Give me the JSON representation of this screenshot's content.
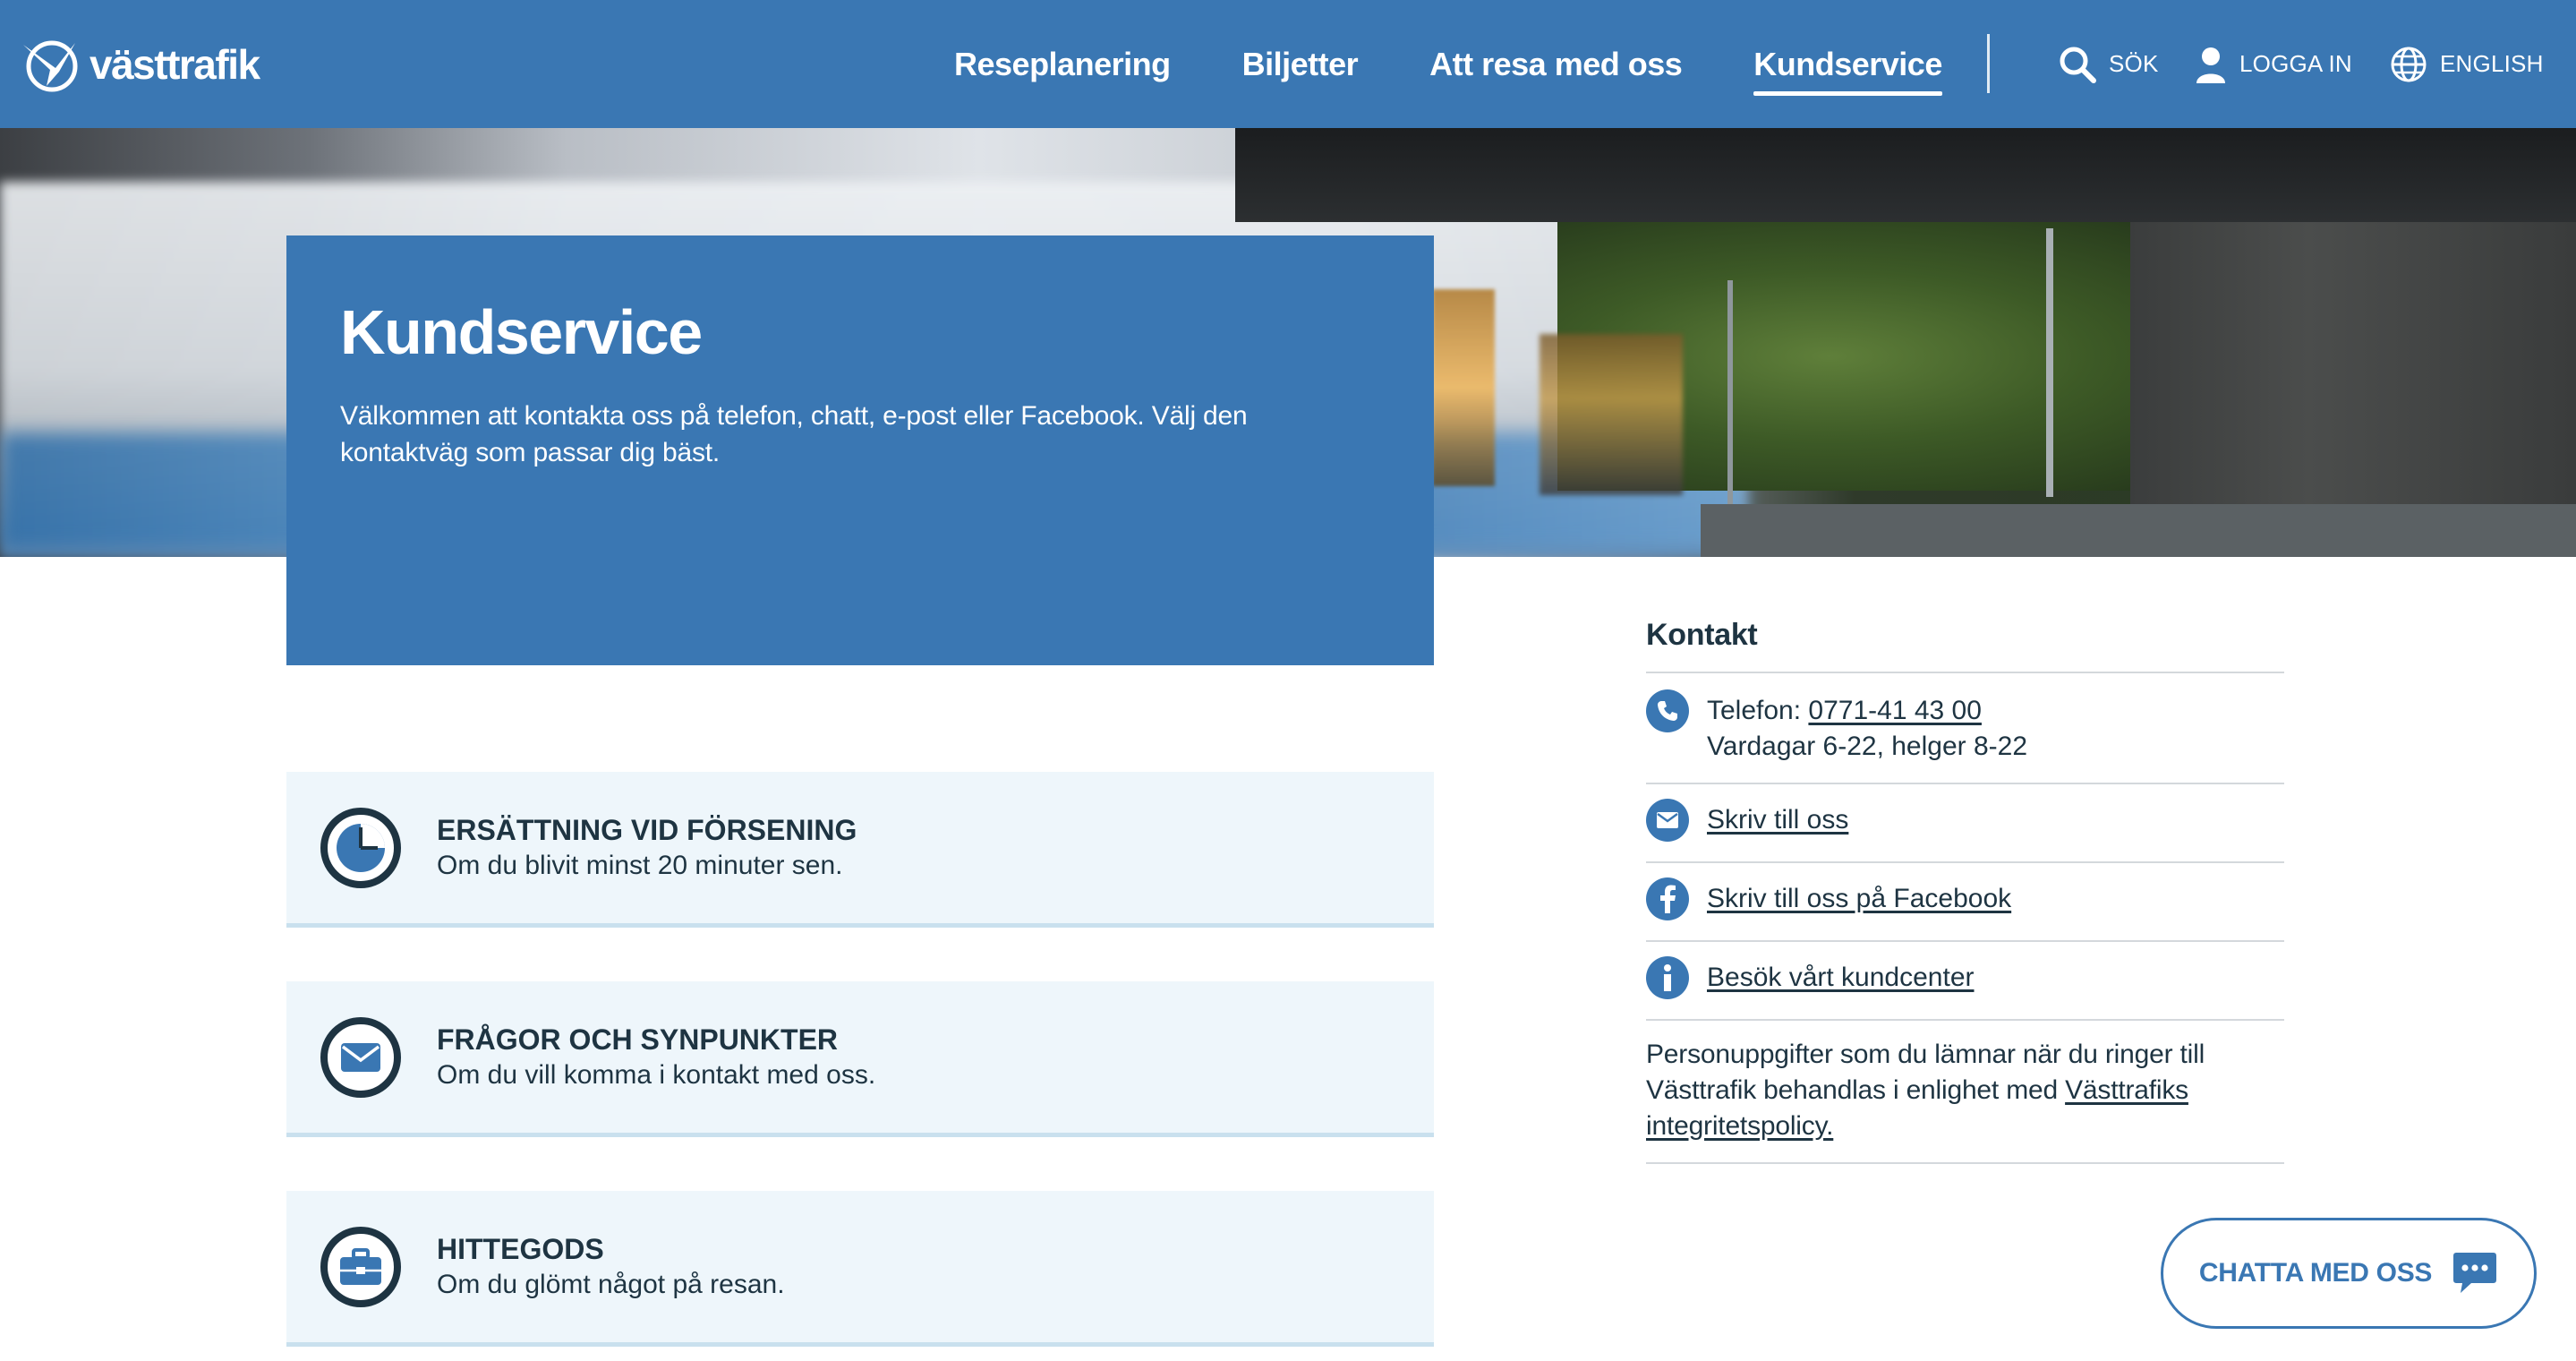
{
  "header": {
    "logo_text": "västtrafik",
    "nav": [
      {
        "label": "Reseplanering"
      },
      {
        "label": "Biljetter"
      },
      {
        "label": "Att resa med oss"
      },
      {
        "label": "Kundservice"
      }
    ],
    "active_nav": "Kundservice",
    "search_label": "SÖK",
    "login_label": "LOGGA IN",
    "lang_label": "ENGLISH"
  },
  "hero": {
    "title": "Kundservice",
    "intro": "Välkommen att kontakta oss på telefon, chatt, e-post eller Facebook. Välj den kontaktväg som passar dig bäst."
  },
  "cards": [
    {
      "title": "ERSÄTTNING VID FÖRSENING",
      "subtitle": "Om du blivit minst 20 minuter sen.",
      "icon": "clock-icon"
    },
    {
      "title": "FRÅGOR OCH SYNPUNKTER",
      "subtitle": "Om du vill komma i kontakt med oss.",
      "icon": "envelope-icon"
    },
    {
      "title": "HITTEGODS",
      "subtitle": "Om du glömt något på resan.",
      "icon": "briefcase-icon"
    }
  ],
  "contact": {
    "heading": "Kontakt",
    "phone_prefix": "Telefon: ",
    "phone_number": "0771-41 43 00",
    "phone_hours": "Vardagar 6-22, helger 8-22",
    "write_us": "Skriv till oss",
    "facebook": "Skriv till oss på Facebook",
    "visit": "Besök vårt kundcenter",
    "privacy_text": "Personuppgifter som du lämnar när du ringer till Västtrafik behandlas i enlighet med ",
    "privacy_link": "Västtrafiks integritetspolicy."
  },
  "chat": {
    "label": "CHATTA MED OSS"
  },
  "colors": {
    "brand_blue": "#3a77b3",
    "dark_navy": "#1e3442",
    "card_bg": "#eef6fb"
  }
}
